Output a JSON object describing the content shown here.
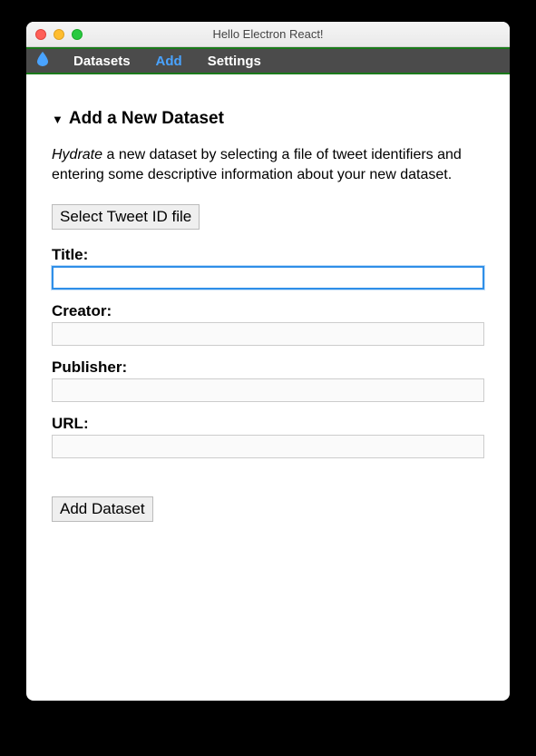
{
  "window": {
    "title": "Hello Electron React!"
  },
  "menu": {
    "datasets": "Datasets",
    "add": "Add",
    "settings": "Settings"
  },
  "heading": "Add a New Dataset",
  "intro": {
    "emph": "Hydrate",
    "rest": " a new dataset by selecting a file of tweet identifiers and entering some descriptive information about your new dataset."
  },
  "buttons": {
    "select_file": "Select Tweet ID file",
    "add_dataset": "Add Dataset"
  },
  "form": {
    "title_label": "Title:",
    "title_value": "",
    "creator_label": "Creator:",
    "creator_value": "",
    "publisher_label": "Publisher:",
    "publisher_value": "",
    "url_label": "URL:",
    "url_value": ""
  }
}
